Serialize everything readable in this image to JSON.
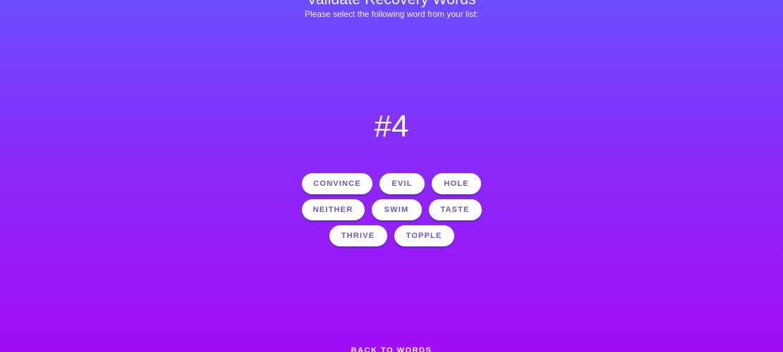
{
  "header": {
    "title": "Validate Recovery Words",
    "subtitle": "Please select the following word from your list:"
  },
  "challenge": {
    "word_number": "#4"
  },
  "choices": {
    "rows": [
      [
        "CONVINCE",
        "EVIL",
        "HOLE"
      ],
      [
        "NEITHER",
        "SWIM",
        "TASTE"
      ],
      [
        "THRIVE",
        "TOPPLE"
      ]
    ]
  },
  "footer": {
    "back_label": "BACK TO WORDS"
  },
  "colors": {
    "gradient_top": "#6c4dff",
    "gradient_bottom": "#a20cf7",
    "button_text": "#6b56c9",
    "button_bg": "#ffffff"
  }
}
